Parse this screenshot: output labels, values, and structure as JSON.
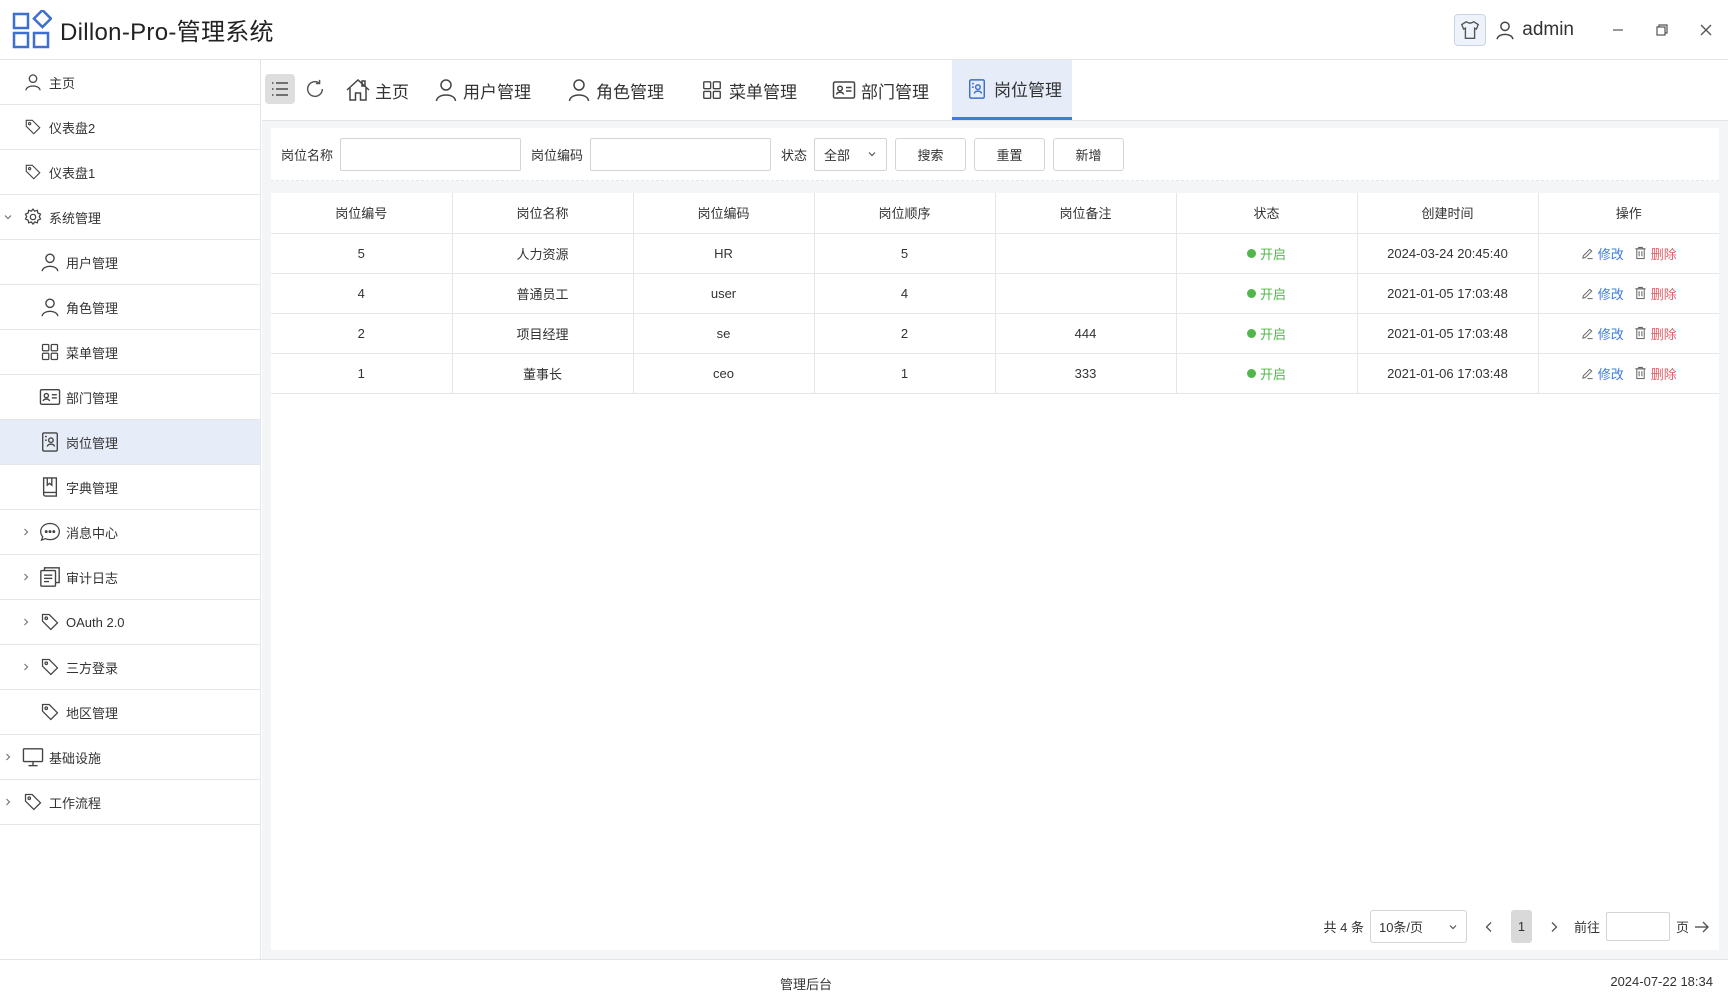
{
  "app": {
    "title": "Dillon-Pro-管理系统",
    "user": "admin",
    "accent": "#3d7be3"
  },
  "window": {
    "minimize_icon": "minimize-icon",
    "restore_icon": "restore-icon",
    "close_icon": "close-icon"
  },
  "sidebar": {
    "items": [
      {
        "label": "主页",
        "icon": "user-icon"
      },
      {
        "label": "仪表盘2",
        "icon": "tag-icon"
      },
      {
        "label": "仪表盘1",
        "icon": "tag-icon"
      },
      {
        "label": "系统管理",
        "icon": "gear-icon",
        "expanded": true
      },
      {
        "label": "用户管理",
        "icon": "user-icon"
      },
      {
        "label": "角色管理",
        "icon": "user-icon"
      },
      {
        "label": "菜单管理",
        "icon": "grid-icon"
      },
      {
        "label": "部门管理",
        "icon": "id-card-icon"
      },
      {
        "label": "岗位管理",
        "icon": "badge-icon",
        "active": true
      },
      {
        "label": "字典管理",
        "icon": "book-icon"
      },
      {
        "label": "消息中心",
        "icon": "message-icon"
      },
      {
        "label": "审计日志",
        "icon": "document-icon"
      },
      {
        "label": "OAuth 2.0",
        "icon": "tag-icon"
      },
      {
        "label": "三方登录",
        "icon": "tag-icon"
      },
      {
        "label": "地区管理",
        "icon": "tag-icon"
      },
      {
        "label": "基础设施",
        "icon": "monitor-icon"
      },
      {
        "label": "工作流程",
        "icon": "tag-icon"
      }
    ]
  },
  "tabs": [
    {
      "label": "主页",
      "icon": "home-icon"
    },
    {
      "label": "用户管理",
      "icon": "user-icon"
    },
    {
      "label": "角色管理",
      "icon": "user-icon"
    },
    {
      "label": "菜单管理",
      "icon": "grid-icon"
    },
    {
      "label": "部门管理",
      "icon": "id-card-icon"
    },
    {
      "label": "岗位管理",
      "icon": "badge-icon",
      "active": true
    }
  ],
  "filter": {
    "name_label": "岗位名称",
    "name_value": "",
    "code_label": "岗位编码",
    "code_value": "",
    "status_label": "状态",
    "status_value": "全部",
    "search_label": "搜索",
    "reset_label": "重置",
    "add_label": "新增"
  },
  "table": {
    "columns": [
      "岗位编号",
      "岗位名称",
      "岗位编码",
      "岗位顺序",
      "岗位备注",
      "状态",
      "创建时间",
      "操作"
    ],
    "rows": [
      {
        "id": "5",
        "name": "人力资源",
        "code": "HR",
        "order": "5",
        "remark": "",
        "status": "开启",
        "created": "2024-03-24 20:45:40"
      },
      {
        "id": "4",
        "name": "普通员工",
        "code": "user",
        "order": "4",
        "remark": "",
        "status": "开启",
        "created": "2021-01-05 17:03:48"
      },
      {
        "id": "2",
        "name": "项目经理",
        "code": "se",
        "order": "2",
        "remark": "444",
        "status": "开启",
        "created": "2021-01-05 17:03:48"
      },
      {
        "id": "1",
        "name": "董事长",
        "code": "ceo",
        "order": "1",
        "remark": "333",
        "status": "开启",
        "created": "2021-01-06 17:03:48"
      }
    ],
    "edit_label": "修改",
    "delete_label": "删除",
    "status_color": "#52b74a",
    "delete_color": "#e25d66"
  },
  "pagination": {
    "total_text": "共 4 条",
    "page_size": "10条/页",
    "current_page": "1",
    "goto_label": "前往",
    "page_suffix": "页",
    "goto_value": ""
  },
  "footer": {
    "center_text": "管理后台",
    "time": "2024-07-22 18:34"
  }
}
